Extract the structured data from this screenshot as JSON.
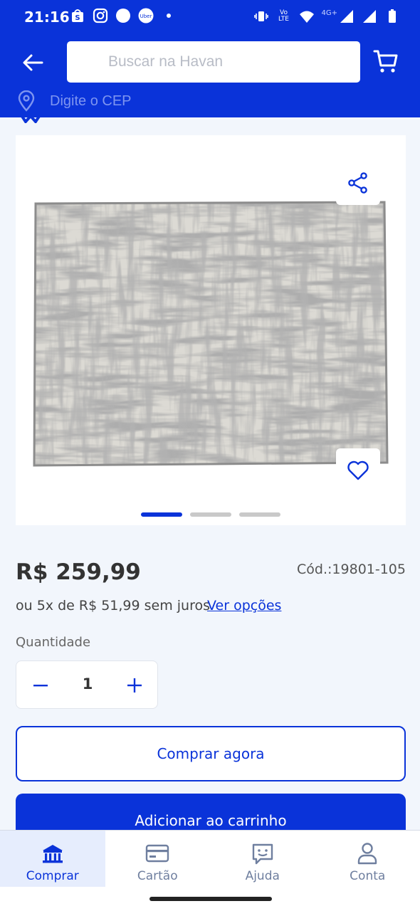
{
  "status_bar": {
    "time": "21:16",
    "left_icons": [
      "shopee-icon",
      "instagram-icon",
      "circle-icon",
      "uber-icon",
      "dot-icon"
    ],
    "right_icons": [
      "vibrate-icon",
      "volte-icon",
      "wifi-icon",
      "signal-4g-icon",
      "signal-icon",
      "battery-icon"
    ],
    "network_label": "4G+",
    "volte_label": "Vo LTE"
  },
  "header": {
    "search_placeholder": "Buscar na Havan",
    "cep_text": "Digite o CEP",
    "accent_color": "#0a33d9"
  },
  "product": {
    "image_alt": "Tapete cinza abstrato",
    "carousel_total": 3,
    "carousel_active": 1,
    "price": "R$ 259,99",
    "sku": "Cód.:19801-105",
    "installments": "ou 5x de R$ 51,99 sem juros",
    "see_options": "Ver opções",
    "quantity_label": "Quantidade",
    "quantity_value": "1",
    "buy_now": "Comprar agora",
    "add_to_cart": "Adicionar ao carrinho"
  },
  "bottom_nav": {
    "items": [
      {
        "label": "Comprar",
        "icon": "store-icon",
        "active": true
      },
      {
        "label": "Cartão",
        "icon": "card-icon",
        "active": false
      },
      {
        "label": "Ajuda",
        "icon": "chat-help-icon",
        "active": false
      },
      {
        "label": "Conta",
        "icon": "person-icon",
        "active": false
      }
    ]
  }
}
